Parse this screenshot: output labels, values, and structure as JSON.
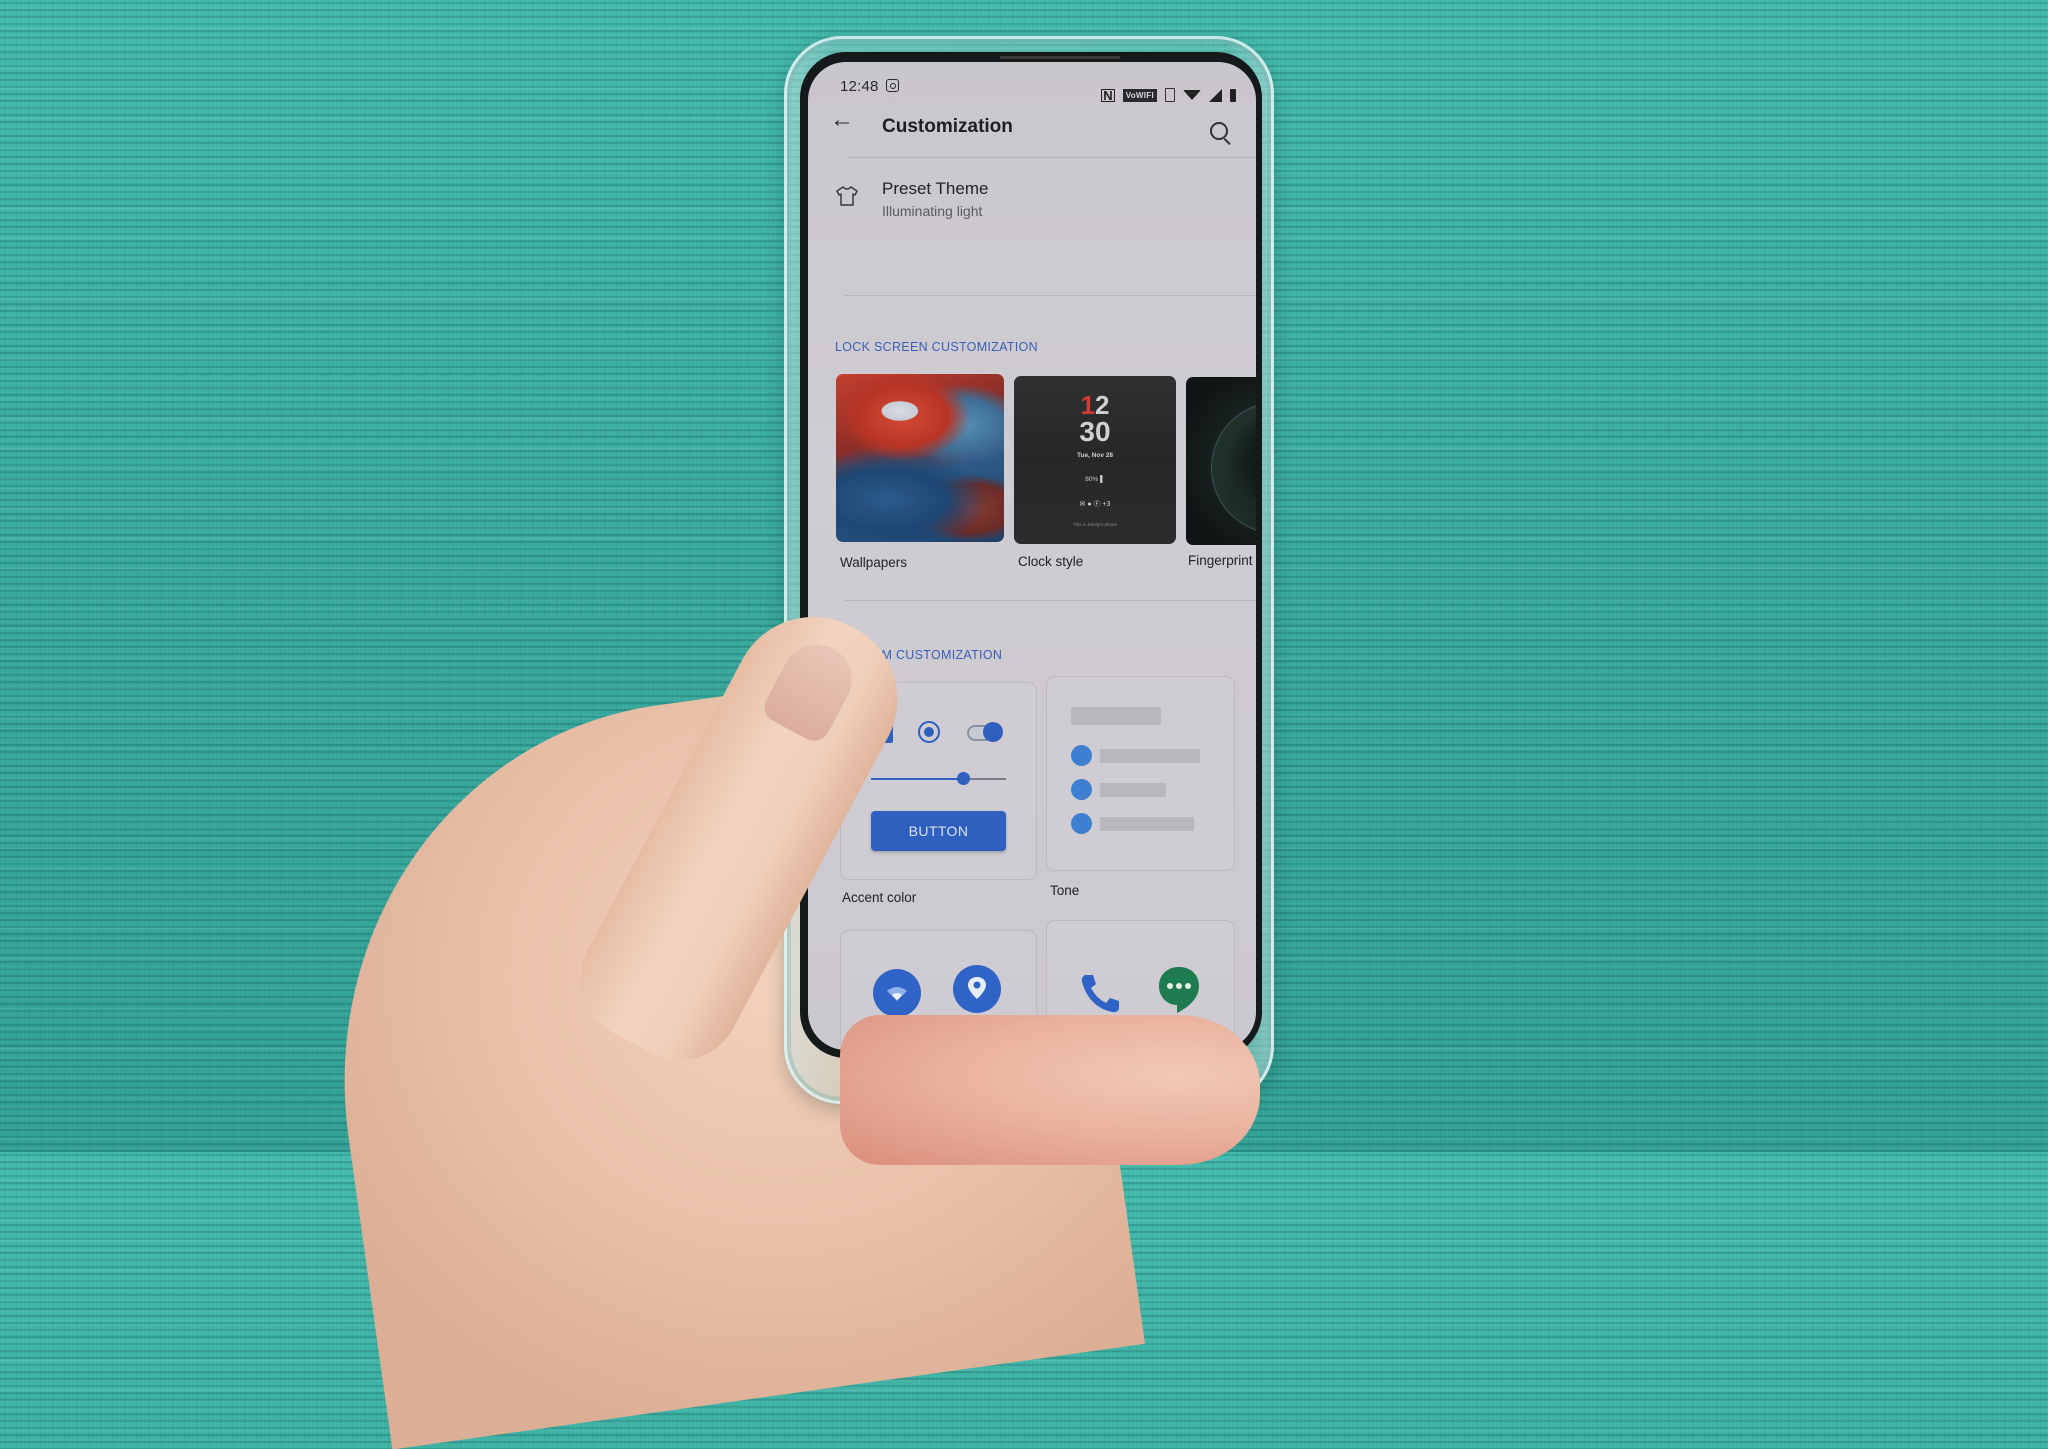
{
  "status_bar": {
    "time": "12:48",
    "notification_icons": [
      "instagram-icon"
    ],
    "system_icons": [
      "nfc-icon",
      "vowifi-icon",
      "vibrate-icon",
      "wifi-icon",
      "signal-icon",
      "battery-icon"
    ],
    "nfc_label": "N",
    "vowifi_label": "VoWIFI"
  },
  "app_bar": {
    "title": "Customization",
    "back_icon": "←"
  },
  "preset_theme": {
    "title": "Preset Theme",
    "subtitle": "Illuminating light"
  },
  "lock_screen": {
    "header": "LOCK SCREEN CUSTOMIZATION",
    "items": [
      {
        "label": "Wallpapers"
      },
      {
        "label": "Clock style"
      },
      {
        "label": "Fingerprint"
      }
    ],
    "clock_preview": {
      "hour_first_digit": "1",
      "hour_second_digit": "2",
      "minutes": "30",
      "date": "Tue, Nov 28",
      "battery": "80% ▌",
      "notifications": "✉ ● Ⓕ +3",
      "owner": "This is Jamity's phone"
    }
  },
  "system": {
    "header": "SYSTEM CUSTOMIZATION",
    "accent": {
      "label": "Accent color",
      "button_label": "BUTTON",
      "slider_value_percent": 68,
      "checkbox_checked": true,
      "radio_selected": true,
      "toggle_on": true
    },
    "tone": {
      "label": "Tone"
    }
  },
  "colors": {
    "accent": "#2f5fbf",
    "section_header": "#3a5fb8",
    "tone_dot": "#3f7fd2",
    "hangouts_green": "#1e7a4f",
    "phone_blue": "#2f63c6"
  }
}
